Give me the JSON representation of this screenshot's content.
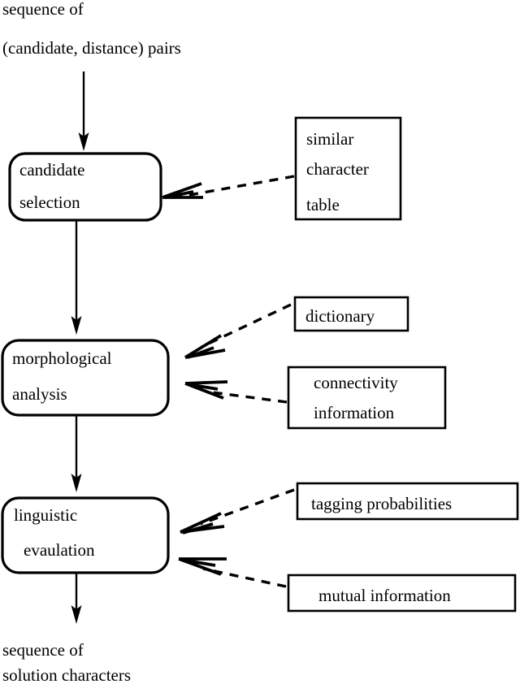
{
  "figure": {
    "type": "flowchart",
    "orientation": "vertical",
    "title_text": null
  },
  "inputs": {
    "top_label_line1": "sequence of",
    "top_label_line2": "(candidate, distance) pairs"
  },
  "outputs": {
    "bottom_label_line1": "sequence of",
    "bottom_label_line2": "solution characters"
  },
  "process_steps": [
    {
      "id": "candidate-selection",
      "line1": "candidate",
      "line2": "selection"
    },
    {
      "id": "morphological-analysis",
      "line1": "morphological",
      "line2": "analysis"
    },
    {
      "id": "linguistic-evaluation",
      "line1": "linguistic",
      "line2": "evaulation"
    }
  ],
  "resources": [
    {
      "id": "similar-character-table",
      "line1": "similar",
      "line2": "character",
      "line3": "table",
      "feeds": "candidate-selection"
    },
    {
      "id": "dictionary",
      "line1": "dictionary",
      "feeds": "morphological-analysis"
    },
    {
      "id": "connectivity-information",
      "line1": "connectivity",
      "line2": "information",
      "feeds": "morphological-analysis"
    },
    {
      "id": "tagging-probabilities",
      "line1": "tagging probabilities",
      "feeds": "linguistic-evaluation"
    },
    {
      "id": "mutual-information",
      "line1": "mutual information",
      "feeds": "linguistic-evaluation"
    }
  ],
  "colors": {
    "background": "#ffffff",
    "stroke": "#000000",
    "text": "#000000"
  }
}
